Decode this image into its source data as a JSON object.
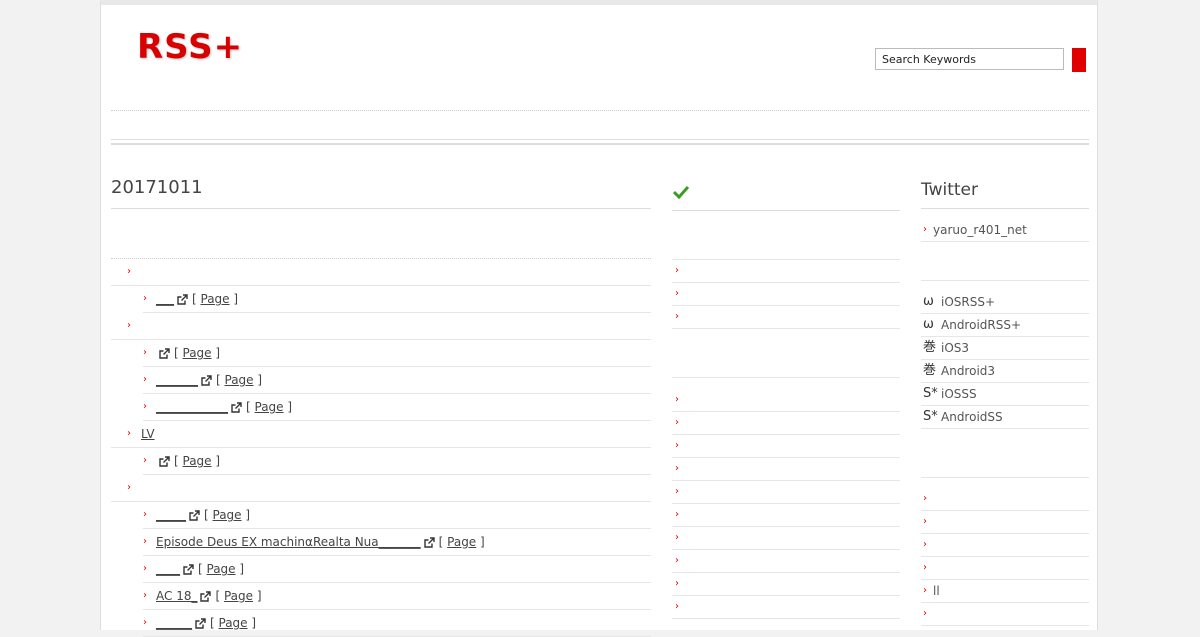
{
  "header": {
    "logo": "RSS+",
    "search_placeholder": "Search Keywords"
  },
  "main": {
    "date_title": "20171011",
    "page_label": "Page",
    "items": [
      {
        "type": "cat",
        "label": ""
      },
      {
        "type": "sub",
        "label": "___",
        "has_page": true
      },
      {
        "type": "cat",
        "label": ""
      },
      {
        "type": "sub",
        "label": "",
        "has_page": true
      },
      {
        "type": "sub",
        "label": "_______",
        "has_page": true
      },
      {
        "type": "sub",
        "label": "____________",
        "has_page": true
      },
      {
        "type": "cat",
        "label": "LV"
      },
      {
        "type": "sub",
        "label": "",
        "has_page": true
      },
      {
        "type": "cat",
        "label": ""
      },
      {
        "type": "sub",
        "label": "_____",
        "has_page": true
      },
      {
        "type": "sub",
        "label": " Episode Deus EX machinαRealta Nua_______",
        "has_page": true
      },
      {
        "type": "sub",
        "label": "____",
        "has_page": true
      },
      {
        "type": "sub",
        "label": " AC 18_",
        "has_page": true
      },
      {
        "type": "sub",
        "label": "______",
        "has_page": true
      }
    ]
  },
  "middle": {
    "check_icon": "check-icon",
    "check_color": "#3a9d23",
    "group1_count": 3,
    "group2_count": 10
  },
  "sidebar": {
    "twitter_title": "Twitter",
    "twitter_account": "yaruo_r401_net",
    "apps": [
      {
        "icon": "ω",
        "icon_name": "omega-icon",
        "label": "iOSRSS+"
      },
      {
        "icon": "ω",
        "icon_name": "omega-icon",
        "label": "AndroidRSS+"
      },
      {
        "icon": "巻",
        "icon_name": "scroll-kanji-icon",
        "label": "iOS3"
      },
      {
        "icon": "巻",
        "icon_name": "scroll-kanji-icon",
        "label": "Android3"
      },
      {
        "icon": "S*",
        "icon_name": "s-star-icon",
        "label": "iOSSS"
      },
      {
        "icon": "S*",
        "icon_name": "s-star-icon",
        "label": "AndroidSS"
      }
    ],
    "bottom_items": [
      "",
      "",
      "",
      "",
      "ll",
      ""
    ]
  },
  "colors": {
    "brand_red": "#d90000",
    "chevron_red": "#dd0000"
  }
}
